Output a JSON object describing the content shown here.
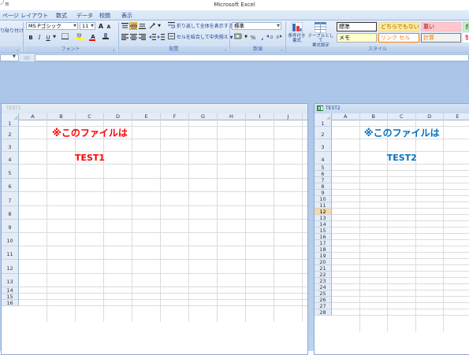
{
  "app": {
    "title": "Microsoft Excel",
    "qat_arrow": "≡"
  },
  "menu": {
    "tabs": [
      "ペ一ジ レイアウト",
      "数式",
      "デ一タ",
      "校閲",
      "表示"
    ]
  },
  "ribbon": {
    "clipboard": {
      "paste_fragment": "り貼り付け"
    },
    "font": {
      "font_name": "MS Pゴシック",
      "font_size": "11",
      "grow_label": "A",
      "shrink_label": "A",
      "bold": "B",
      "italic": "I",
      "underline": "U",
      "font_color_label": "A",
      "group_label": "フォント"
    },
    "alignment": {
      "wrap_text": "折り返して全体を表示する",
      "merge_center": "セルを結合して中央揃え",
      "group_label": "配置"
    },
    "number": {
      "format": "標準",
      "percent": "%",
      "comma": ",",
      "group_label": "数値"
    },
    "styles": {
      "conditional_format": "条件付き\n書式",
      "format_as_table": "テーブルとして\n書式設定",
      "cells": [
        {
          "label": "標準",
          "bg": "#ffffff",
          "fg": "#000000",
          "border": "#333333"
        },
        {
          "label": "どちらでもない",
          "bg": "#ffeb9c",
          "fg": "#9c6500",
          "border": "#e8d9a8"
        },
        {
          "label": "悪い",
          "bg": "#ffc7ce",
          "fg": "#9c0006",
          "border": "#eec0c4"
        },
        {
          "label": "良",
          "bg": "#c6efce",
          "fg": "#006100",
          "border": "#b9e0c1"
        },
        {
          "label": "メモ",
          "bg": "#ffffcc",
          "fg": "#000000",
          "border": "#b2b2b2"
        },
        {
          "label": "リンク セル",
          "bg": "#ffffff",
          "fg": "#fa7d00",
          "border": "#ff8001"
        },
        {
          "label": "計算",
          "bg": "#f2f2f2",
          "fg": "#fa7d00",
          "border": "#7f7f7f"
        },
        {
          "label": "警",
          "bg": "#ffffff",
          "fg": "#ff0000",
          "border": "#ffffff"
        }
      ],
      "group_label": "スタイル"
    }
  },
  "workbooks": [
    {
      "title": "TEST1",
      "columns": [
        "A",
        "B",
        "C",
        "D",
        "E",
        "F",
        "G",
        "H",
        "I",
        "J"
      ],
      "rows": [
        "1",
        "2",
        "3",
        "4",
        "5",
        "6",
        "7",
        "8",
        "9",
        "10",
        "11",
        "12",
        "13",
        "14",
        "15",
        "16"
      ],
      "active_row": "",
      "line1": "※このファイルは",
      "line2": "TEST1",
      "text_color": "#ff0000",
      "active": false
    },
    {
      "title": "TEST2",
      "columns": [
        "A",
        "B",
        "C",
        "D",
        "E"
      ],
      "rows": [
        "1",
        "2",
        "3",
        "4",
        "5",
        "6",
        "7",
        "8",
        "9",
        "10",
        "11",
        "12",
        "13",
        "14",
        "15",
        "16",
        "17",
        "18",
        "19",
        "20",
        "21",
        "22",
        "23",
        "24",
        "25",
        "26",
        "27",
        "28"
      ],
      "active_row": "12",
      "line1": "※このファイルは",
      "line2": "TEST2",
      "text_color": "#0070c0",
      "active": true
    }
  ],
  "colors": {
    "workspace": "#b3cbea",
    "ribbon": "#d4e2f4"
  }
}
